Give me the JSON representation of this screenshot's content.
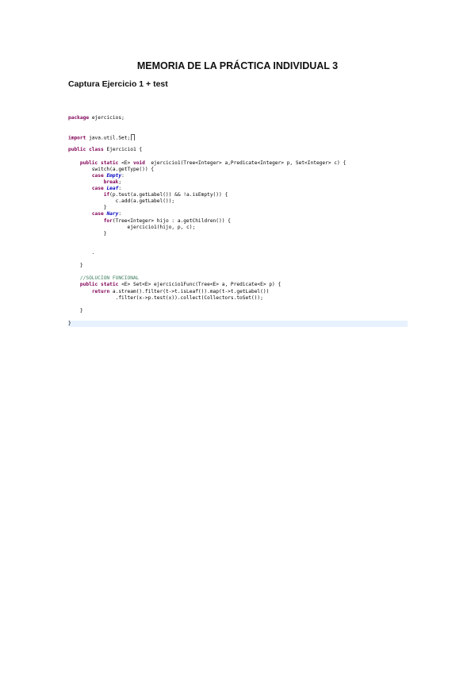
{
  "document": {
    "title": "MEMORIA DE LA PRÁCTICA INDIVIDUAL 3",
    "section_heading": "Captura Ejercicio 1 + test"
  },
  "code": {
    "lines": [
      [
        {
          "t": "package ",
          "c": "kw"
        },
        {
          "t": "ejercicios;",
          "c": ""
        }
      ],
      [],
      [],
      [
        {
          "t": "import ",
          "c": "kw"
        },
        {
          "t": "java.util.Set;",
          "c": ""
        }
      ],
      [],
      [
        {
          "t": "public ",
          "c": "kw"
        },
        {
          "t": "class ",
          "c": "kw"
        },
        {
          "t": "Ejercicio1 {",
          "c": ""
        }
      ],
      [],
      [
        {
          "t": "    "
        },
        {
          "t": "public ",
          "c": "kw"
        },
        {
          "t": "static ",
          "c": "kw"
        },
        {
          "t": "<E> "
        },
        {
          "t": "void ",
          "c": "kw"
        },
        {
          "t": " ejercicio1(Tree<Integer> a,Predicate<Integer> p, Set<Integer> c) {"
        }
      ],
      [
        {
          "t": "        switch(a.getType()) {"
        }
      ],
      [
        {
          "t": "        "
        },
        {
          "t": "case ",
          "c": "kw"
        },
        {
          "t": "Empty",
          "c": "ty"
        },
        {
          "t": ":"
        }
      ],
      [
        {
          "t": "            "
        },
        {
          "t": "break",
          "c": "kw"
        },
        {
          "t": ";"
        }
      ],
      [
        {
          "t": "        "
        },
        {
          "t": "case ",
          "c": "kw"
        },
        {
          "t": "Leaf",
          "c": "ty"
        },
        {
          "t": ":"
        }
      ],
      [
        {
          "t": "            "
        },
        {
          "t": "if",
          "c": "kw"
        },
        {
          "t": "(p.test(a.getLabel()) && !a.isEmpty()) {"
        }
      ],
      [
        {
          "t": "                c.add(a.getLabel());"
        }
      ],
      [
        {
          "t": "            }"
        }
      ],
      [
        {
          "t": "        "
        },
        {
          "t": "case ",
          "c": "kw"
        },
        {
          "t": "Nary",
          "c": "ty"
        },
        {
          "t": ":"
        }
      ],
      [
        {
          "t": "            "
        },
        {
          "t": "for",
          "c": "kw"
        },
        {
          "t": "(Tree<Integer> hijo : a.getChildren()) {"
        }
      ],
      [
        {
          "t": "                    ejercicio1(hijo, p, c);"
        }
      ],
      [
        {
          "t": "            }"
        }
      ],
      [],
      [],
      [
        {
          "t": "        ."
        }
      ],
      [],
      [
        {
          "t": "    }"
        }
      ],
      [],
      [
        {
          "t": "    "
        },
        {
          "t": "//SOLUCIÓN FUNCIONAL",
          "c": "cm"
        }
      ],
      [
        {
          "t": "    "
        },
        {
          "t": "public ",
          "c": "kw"
        },
        {
          "t": "static ",
          "c": "kw"
        },
        {
          "t": "<E> Set<E> ejercicio1Func(Tree<E> a, Predicate<E> p) {"
        }
      ],
      [
        {
          "t": "        "
        },
        {
          "t": "return ",
          "c": "kw"
        },
        {
          "t": "a.stream().filter(t->t.isLeaf()).map(t->t.getLabel())"
        }
      ],
      [
        {
          "t": "                .filter(x->p.test(x)).collect(Collectors.toSet());"
        }
      ],
      [],
      [
        {
          "t": "    }"
        }
      ],
      [],
      [
        {
          "t": "}"
        }
      ]
    ]
  }
}
